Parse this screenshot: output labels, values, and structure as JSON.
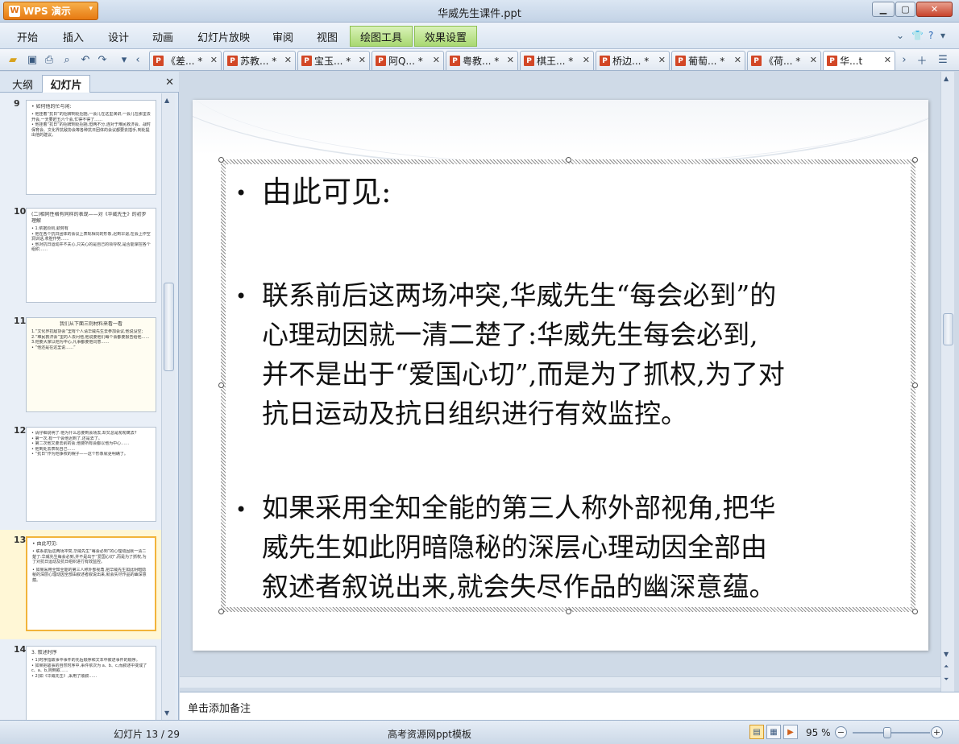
{
  "app": {
    "button_label": "WPS 演示",
    "window_title": "华威先生课件.ppt"
  },
  "menu": {
    "items": [
      "开始",
      "插入",
      "设计",
      "动画",
      "幻灯片放映",
      "审阅",
      "视图"
    ],
    "green_tabs": [
      "绘图工具",
      "效果设置"
    ]
  },
  "doc_tabs": [
    {
      "label": "《差... *"
    },
    {
      "label": "苏教... *"
    },
    {
      "label": "宝玉... *"
    },
    {
      "label": "阿Q... *"
    },
    {
      "label": "粤教... *"
    },
    {
      "label": "棋王... *"
    },
    {
      "label": "桥边... *"
    },
    {
      "label": "葡萄... *"
    },
    {
      "label": "《荷... *"
    },
    {
      "label": "华...t"
    }
  ],
  "left_panel": {
    "tab_outline": "大纲",
    "tab_slides": "幻灯片"
  },
  "thumbnails": [
    {
      "num": "9",
      "lines": [
        "• 如何他的忙与闲:",
        "• 他挂着“抗日”的招牌到处招摇,一会儿在这里演讲,一会儿在那里去开会,一天要赶五六个会,忙得不得了……",
        "• 他挂着“抗日”的招牌到处招摇,但两不分,连对于难民救济会、战时保育会、文化界抗敌协会等各种抗日团体的会议都要去插手,到处提出他的建议。"
      ]
    },
    {
      "num": "10",
      "lines": [
        "(二)相同性格有同样的表现——对《华威先生》的初步理解",
        "• 1.依据原则,勤劳有",
        "• 他在各个抗日团体的会议上表现相同的形象,迟到早退,在会上作空洞训话,拿腔作势……",
        "• 他对抗日运动并不关心,只关心的是自己的领导权,是否能掌控各个组织……"
      ]
    },
    {
      "num": "11",
      "lines": [
        "我们从下面三则材料来看一看",
        "1.“文化界抗敌协会”里有个人请华威先生去参加会议,他说没空;",
        "2.“难民救济会”里的人去问他,他说要他们每个会都要报告给他……",
        "3.他要大家以他为中心,凡事都要他同意……",
        "• “他还是在这里说……”"
      ]
    },
    {
      "num": "12",
      "lines": [
        "• 请仔细说明了:他为什么总要到会场去,却又总是匆匆离去?",
        "• 第一次,有一个会他迟到了,还是去了。",
        "• 第二次他又要去别的会,他要所有会都以他为中心……",
        "• 他到处去表现自己……",
        "• “抗日”作为他争权的幌子——这个形象就更明确了。"
      ]
    },
    {
      "num": "13",
      "lines": [
        "• 由此可见:",
        "• 联系前后这两场冲突,华威先生“每会必到”的心理动因就一清二楚了:华威先生每会必到,并不是出于“爱国心切”,而是为了抓权,为了对抗日运动及抗日组织进行有效监控。",
        "• 如果采用全知全能的第三人称外部视角,把华威先生如此阴暗隐秘的深层心理动因全部由叙述者叙说出来,就会失尽作品的幽深意蕴。"
      ]
    },
    {
      "num": "14",
      "lines": [
        "3. 叙述时序",
        "• 1)时序指故事中事件的先后顺序和文本中叙述事件的顺序。",
        "• 如果把故事的自然时序中,事件依次为 a、b、c,而叙述中变成了 c、a、b,则倒叙……",
        "• 2)如《华威先生》,采用了顺叙……"
      ]
    }
  ],
  "slide": {
    "bullets": [
      [
        "由此可见:"
      ],
      [
        "联系前后这两场冲突,华威先生“每会必到”的",
        "心理动因就一清二楚了:华威先生每会必到,",
        "并不是出于“爱国心切”,而是为了抓权,为了对",
        "抗日运动及抗日组织进行有效监控。"
      ],
      [
        "如果采用全知全能的第三人称外部视角,把华",
        "威先生如此阴暗隐秘的深层心理动因全部由",
        "叙述者叙说出来,就会失尽作品的幽深意蕴。"
      ]
    ]
  },
  "notes_placeholder": "单击添加备注",
  "status": {
    "slide_counter": "幻灯片 13 / 29",
    "template": "高考资源网ppt模板",
    "zoom": "95 %",
    "zoom_percent": 95
  },
  "colors": {
    "accent_orange": "#e77a12",
    "selected_thumb_border": "#f2b43b",
    "green_tab": "#a9d872"
  }
}
